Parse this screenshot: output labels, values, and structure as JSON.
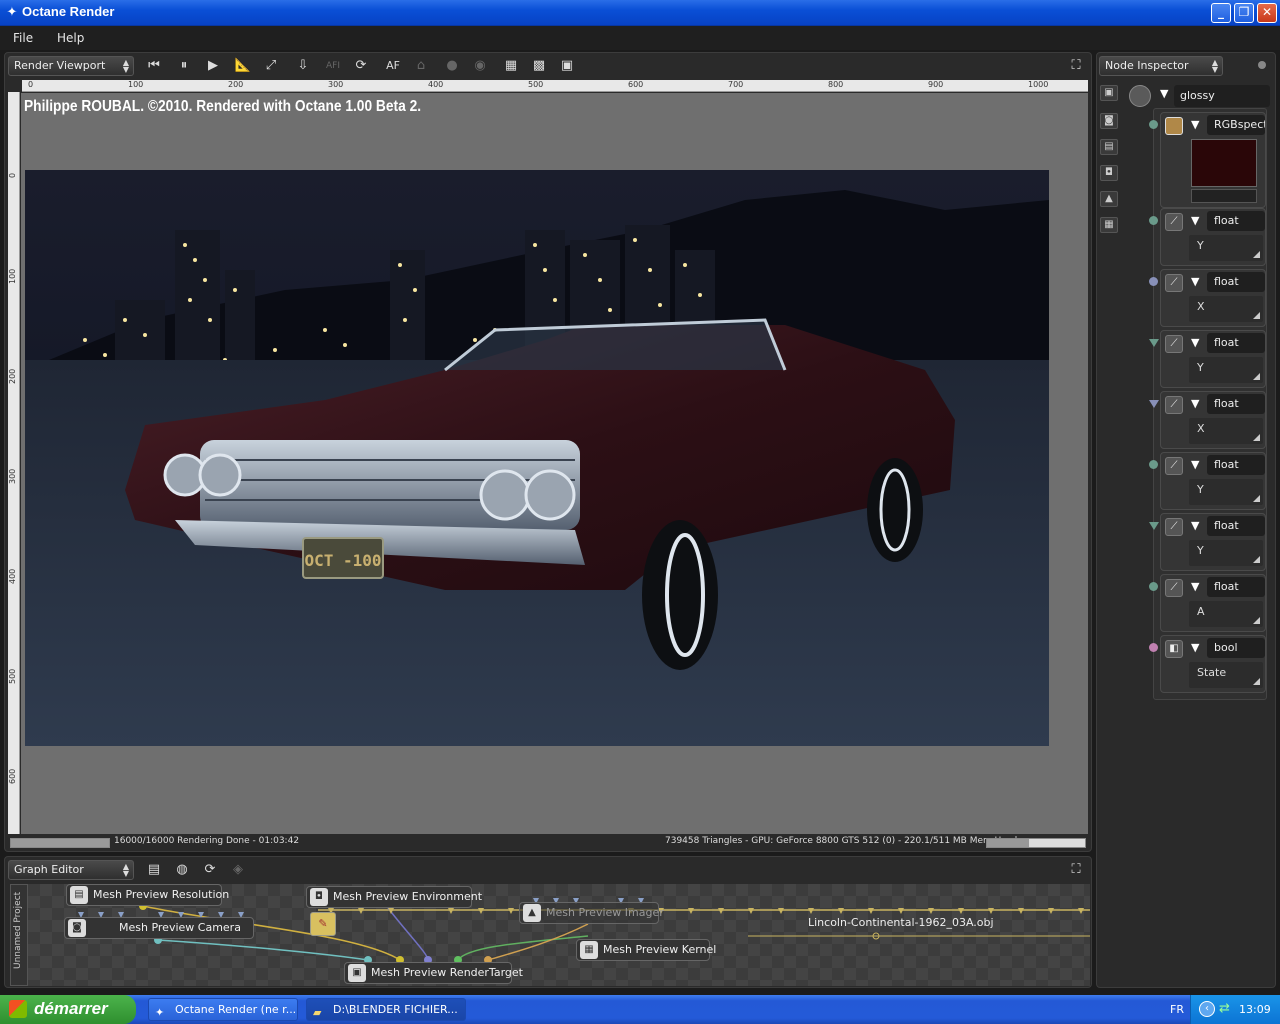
{
  "window": {
    "title": "Octane Render",
    "minimize": "_",
    "maximize": "❐",
    "close": "✕"
  },
  "menu": [
    "File",
    "Help"
  ],
  "viewport": {
    "dropdown": "Render Viewport",
    "ruler_top": [
      "0",
      "100",
      "200",
      "300",
      "400",
      "500",
      "600",
      "700",
      "800",
      "900",
      "1000"
    ],
    "ruler_left": [
      "0",
      "100",
      "200",
      "300",
      "400",
      "500",
      "600"
    ],
    "caption": "Philippe ROUBAL. ©2010. Rendered with Octane 1.00 Beta 2.",
    "license_plate": "OCT -100"
  },
  "status": {
    "left": "16000/16000 Rendering Done - 01:03:42",
    "right": "739458 Triangles - GPU: GeForce 8800 GTS 512 (0) - 220.1/511 MB Mem Used",
    "progress": 1.0,
    "mem_fraction": 0.43
  },
  "inspector": {
    "dropdown": "Node Inspector",
    "material": "glossy",
    "rgb": "RGBspectru",
    "color": "#2a0608",
    "rows": [
      {
        "type": "float",
        "field": "Y",
        "pin": "#6a9a8a",
        "pin_shape": "circle"
      },
      {
        "type": "float",
        "field": "X",
        "pin": "#8890b8",
        "pin_shape": "circle"
      },
      {
        "type": "float",
        "field": "Y",
        "pin": "#6a9a8a",
        "pin_shape": "triangle"
      },
      {
        "type": "float",
        "field": "X",
        "pin": "#8890b8",
        "pin_shape": "triangle"
      },
      {
        "type": "float",
        "field": "Y",
        "pin": "#6a9a8a",
        "pin_shape": "circle"
      },
      {
        "type": "float",
        "field": "Y",
        "pin": "#6a9a8a",
        "pin_shape": "triangle"
      },
      {
        "type": "float",
        "field": "A",
        "pin": "#6a9a8a",
        "pin_shape": "circle"
      },
      {
        "type": "bool",
        "field": "State",
        "pin": "#c080b0",
        "pin_shape": "circle"
      }
    ]
  },
  "graph": {
    "dropdown": "Graph Editor",
    "tab": "Unnamed Project",
    "nodes": {
      "resolution": "Mesh Preview Resolution",
      "camera": "Mesh Preview Camera",
      "environment": "Mesh Preview Environment",
      "imager": "Mesh Preview Imager",
      "kernel": "Mesh Preview Kernel",
      "rendertarget": "Mesh Preview RenderTarget",
      "mesh": "Lincoln-Continental-1962_03A.obj"
    }
  },
  "taskbar": {
    "start": "démarrer",
    "items": [
      "Octane Render (ne r...",
      "D:\\BLENDER FICHIER..."
    ],
    "lang": "FR",
    "clock": "13:09"
  }
}
